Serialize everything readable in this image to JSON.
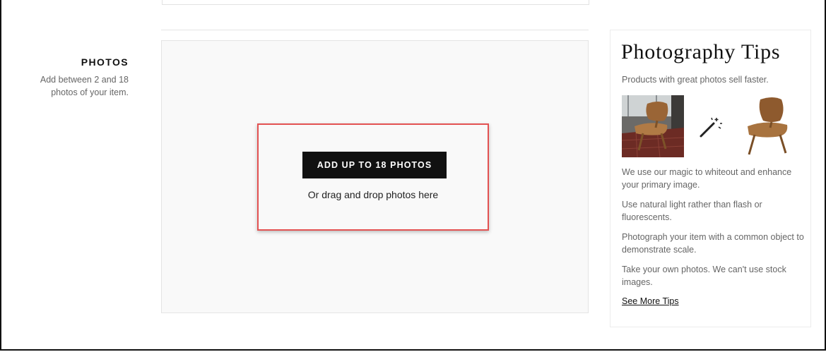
{
  "photos_section": {
    "title": "PHOTOS",
    "description": "Add between 2 and 18 photos of your item."
  },
  "dropzone": {
    "button_label": "ADD UP TO 18 PHOTOS",
    "drag_hint": "Or drag and drop photos here"
  },
  "tips": {
    "title": "Photography Tips",
    "subtitle": "Products with great photos sell faster.",
    "items": [
      "We use our magic to whiteout and enhance your primary image.",
      "Use natural light rather than flash or fluorescents.",
      "Photograph your item with a common object to demonstrate scale.",
      "Take your own photos. We can't use stock images."
    ],
    "see_more_label": "See More Tips",
    "icons": [
      "chair-photo-before",
      "magic-wand-icon",
      "chair-photo-after"
    ]
  },
  "colors": {
    "button_bg": "#111111",
    "highlight_border": "#e35252",
    "dropzone_bg": "#f9f9f9"
  }
}
